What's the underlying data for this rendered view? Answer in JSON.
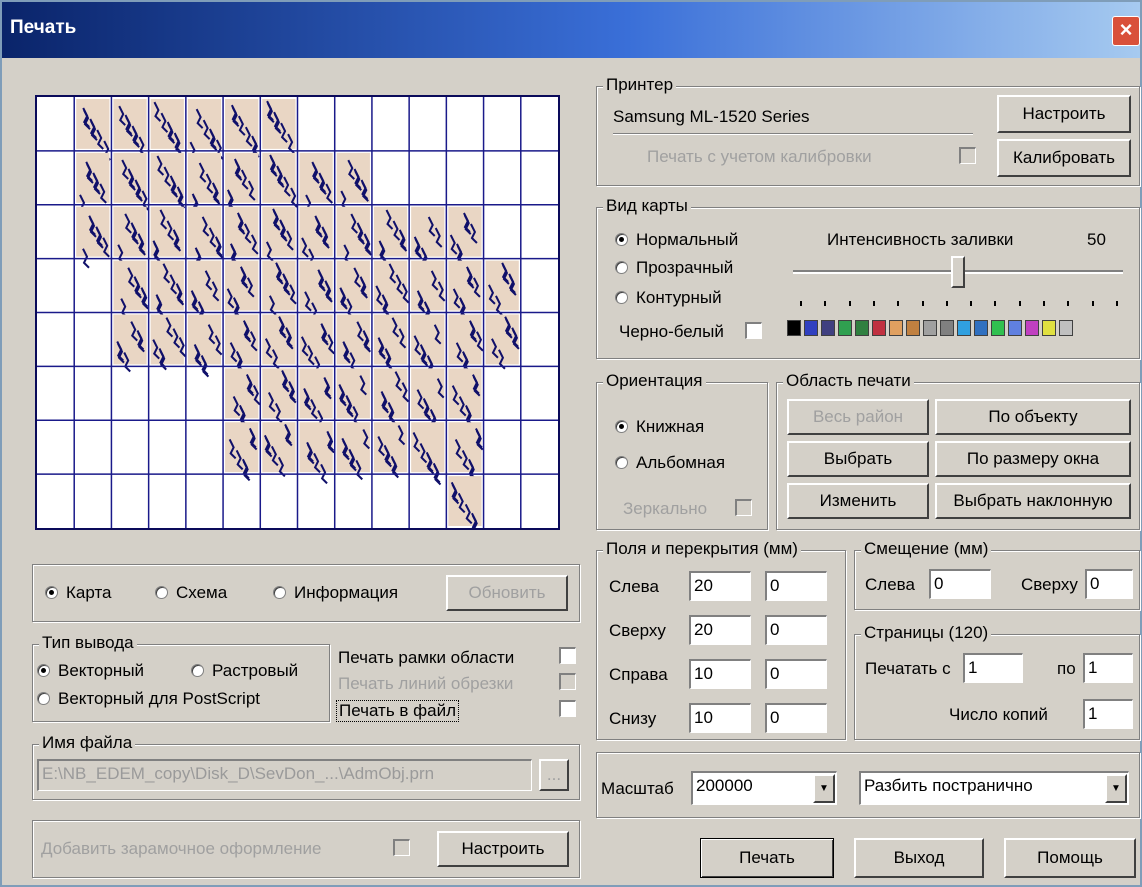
{
  "window": {
    "title": "Печать",
    "close_glyph": "×"
  },
  "view_mode": {
    "options": [
      "Карта",
      "Схема",
      "Информация"
    ],
    "selected": "Карта",
    "refresh_label": "Обновить"
  },
  "output_type": {
    "legend": "Тип вывода",
    "vector": "Векторный",
    "raster": "Растровый",
    "vector_ps": "Векторный для PostScript",
    "selected": "Векторный"
  },
  "print_options": {
    "frame": "Печать рамки области",
    "cut_lines": "Печать линий обрезки",
    "to_file": "Печать в файл"
  },
  "file_name": {
    "legend": "Имя файла",
    "value": "E:\\NB_EDEM_copy\\Disk_D\\SevDon_...\\AdmObj.prn",
    "browse": "..."
  },
  "decoration": {
    "label": "Добавить зарамочное оформление",
    "setup_label": "Настроить"
  },
  "printer": {
    "legend": "Принтер",
    "name": "Samsung ML-1520 Series",
    "setup_label": "Настроить",
    "calibration_label": "Печать с учетом калибровки",
    "calibrate_label": "Калибровать"
  },
  "map_view": {
    "legend": "Вид карты",
    "normal": "Нормальный",
    "transparent": "Прозрачный",
    "contour": "Контурный",
    "bw": "Черно-белый",
    "selected": "Нормальный",
    "fill_intensity_label": "Интенсивность заливки",
    "fill_intensity_value": "50",
    "fill_intensity_fraction": 0.5,
    "swatches": [
      "#000000",
      "#3040c0",
      "#404080",
      "#30a050",
      "#308040",
      "#c03040",
      "#e0a060",
      "#c08040",
      "#a0a0a0",
      "#808080",
      "#30a0e0",
      "#3070c0",
      "#30c050",
      "#6080e0",
      "#c040c0",
      "#e0e040",
      "#c0c0c0"
    ]
  },
  "orientation": {
    "legend": "Ориентация",
    "portrait": "Книжная",
    "landscape": "Альбомная",
    "mirror": "Зеркально",
    "selected": "Книжная"
  },
  "print_area": {
    "legend": "Область печати",
    "whole": "Весь район",
    "by_object": "По объекту",
    "choose": "Выбрать",
    "by_window": "По размеру окна",
    "change": "Изменить",
    "choose_tilted": "Выбрать наклонную"
  },
  "margins": {
    "legend": "Поля и перекрытия (мм)",
    "rows": [
      {
        "label": "Слева",
        "margin": "20",
        "overlap": "0"
      },
      {
        "label": "Сверху",
        "margin": "20",
        "overlap": "0"
      },
      {
        "label": "Справа",
        "margin": "10",
        "overlap": "0"
      },
      {
        "label": "Снизу",
        "margin": "10",
        "overlap": "0"
      }
    ]
  },
  "offset": {
    "legend": "Смещение (мм)",
    "left_label": "Слева",
    "left": "0",
    "top_label": "Сверху",
    "top": "0"
  },
  "pages": {
    "legend": "Страницы (120)",
    "from_label": "Печатать с",
    "from": "1",
    "to_label": "по",
    "to": "1",
    "copies_label": "Число копий",
    "copies": "1"
  },
  "scale": {
    "label": "Масштаб",
    "value": "200000",
    "mode": "Разбить постранично"
  },
  "actions": {
    "print": "Печать",
    "exit": "Выход",
    "help": "Помощь"
  },
  "colors": {
    "grid": "#1a1a8a",
    "title_start": "#0a246a",
    "face": "#d4d0c8"
  }
}
